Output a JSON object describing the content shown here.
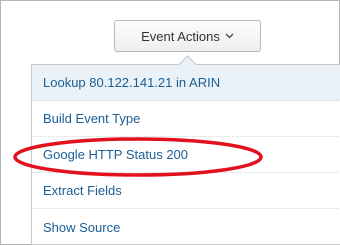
{
  "event_actions": {
    "button_label": "Event Actions",
    "caret_icon": "chevron-down-icon"
  },
  "menu": {
    "items": [
      {
        "label": "Lookup 80.122.141.21 in ARIN"
      },
      {
        "label": "Build Event Type"
      },
      {
        "label": "Google HTTP Status 200"
      },
      {
        "label": "Extract Fields"
      },
      {
        "label": "Show Source"
      }
    ]
  },
  "highlight": {
    "color": "#e3111b",
    "target": "Google HTTP Status 200"
  },
  "colors": {
    "link_blue": "#1a5e95",
    "menu_hover_bg": "#eaf2f8"
  }
}
